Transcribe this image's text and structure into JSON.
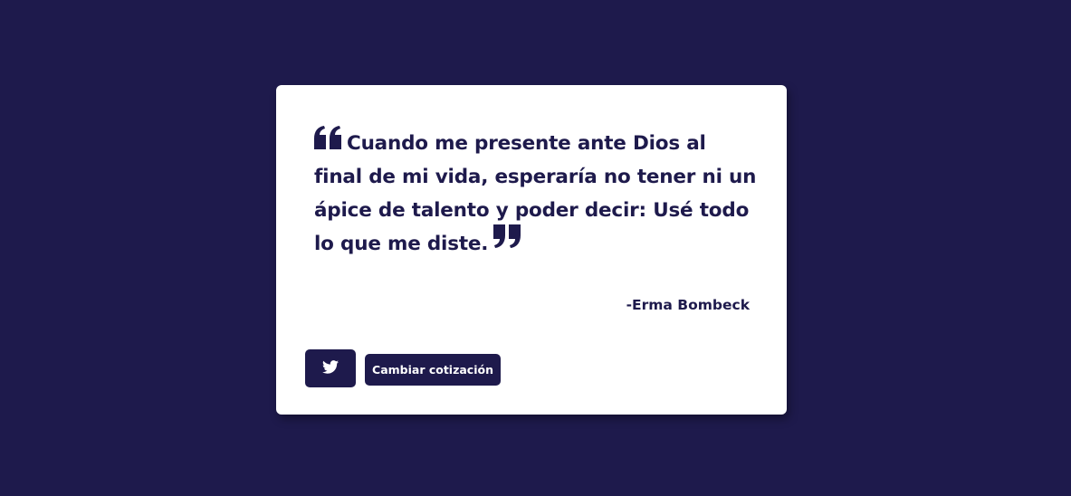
{
  "quote": {
    "text": "Cuando me presente ante Dios al final de mi vida, esperaría no tener ni un ápice de talento y poder decir: Usé todo lo que me diste.",
    "author": "-Erma Bombeck",
    "open_icon": "quote-left-icon",
    "close_icon": "quote-right-icon"
  },
  "actions": {
    "tweet_icon": "twitter-icon",
    "new_quote_label": "Cambiar cotización"
  },
  "colors": {
    "background": "#1e1a4c",
    "card": "#ffffff",
    "accent": "#1e1a4c"
  }
}
